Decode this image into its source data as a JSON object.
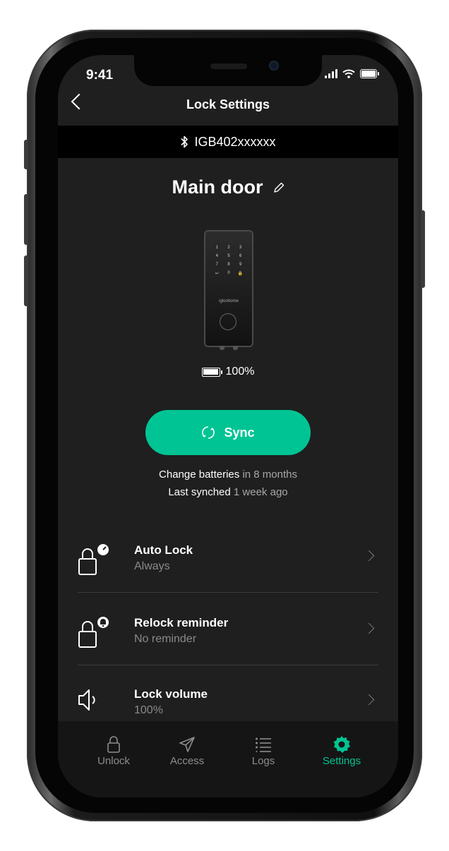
{
  "status_bar": {
    "time": "9:41"
  },
  "header": {
    "title": "Lock Settings"
  },
  "device": {
    "id": "IGB402xxxxxx"
  },
  "lock": {
    "name": "Main door",
    "battery": "100%",
    "keypad_keys": [
      "1",
      "2",
      "3",
      "4",
      "5",
      "6",
      "7",
      "8",
      "9",
      "↩",
      "0",
      "🔒"
    ],
    "brand": "igloohome"
  },
  "sync_button": {
    "label": "Sync"
  },
  "info": {
    "batteries_prefix": "Change batteries",
    "batteries_value": "in 8 months",
    "synched_prefix": "Last synched",
    "synched_value": "1 week ago"
  },
  "settings": [
    {
      "title": "Auto Lock",
      "subtitle": "Always",
      "icon": "lock-clock-icon"
    },
    {
      "title": "Relock reminder",
      "subtitle": "No reminder",
      "icon": "lock-bell-icon"
    },
    {
      "title": "Lock volume",
      "subtitle": "100%",
      "icon": "speaker-icon"
    }
  ],
  "tabs": [
    {
      "label": "Unlock",
      "icon": "unlock-icon"
    },
    {
      "label": "Access",
      "icon": "send-icon"
    },
    {
      "label": "Logs",
      "icon": "list-icon"
    },
    {
      "label": "Settings",
      "icon": "gear-icon",
      "active": true
    }
  ],
  "colors": {
    "accent": "#00c494",
    "background": "#1f1f1f",
    "device_bar": "#000000"
  }
}
